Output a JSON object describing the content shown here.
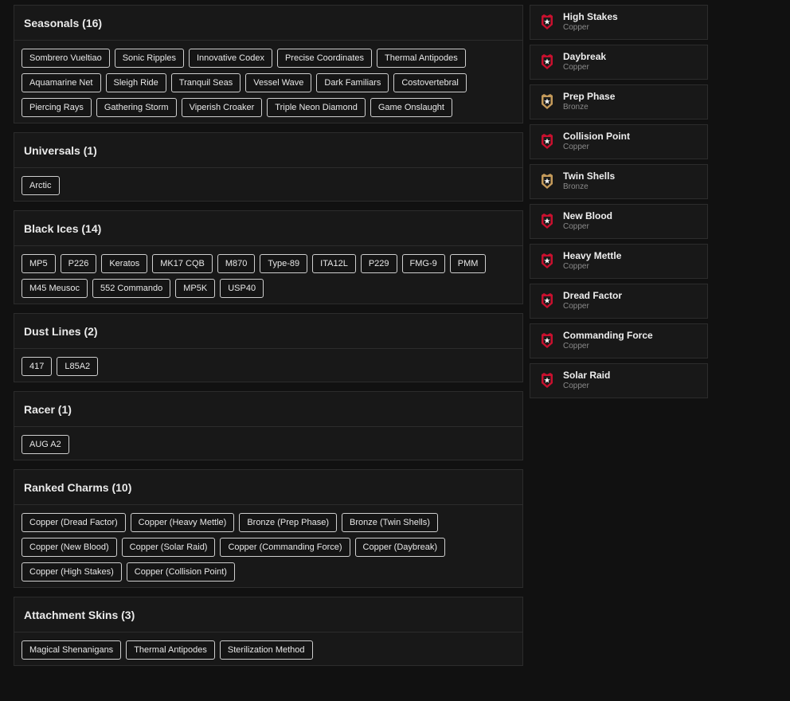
{
  "sections": [
    {
      "title": "Seasonals (16)",
      "items": [
        "Sombrero Vueltiao",
        "Sonic Ripples",
        "Innovative Codex",
        "Precise Coordinates",
        "Thermal Antipodes",
        "Aquamarine Net",
        "Sleigh Ride",
        "Tranquil Seas",
        "Vessel Wave",
        "Dark Familiars",
        "Costovertebral",
        "Piercing Rays",
        "Gathering Storm",
        "Viperish Croaker",
        "Triple Neon Diamond",
        "Game Onslaught"
      ]
    },
    {
      "title": "Universals (1)",
      "items": [
        "Arctic"
      ]
    },
    {
      "title": "Black Ices (14)",
      "items": [
        "MP5",
        "P226",
        "Keratos",
        "MK17 CQB",
        "M870",
        "Type-89",
        "ITA12L",
        "P229",
        "FMG-9",
        "PMM",
        "M45 Meusoc",
        "552 Commando",
        "MP5K",
        "USP40"
      ]
    },
    {
      "title": "Dust Lines (2)",
      "items": [
        "417",
        "L85A2"
      ]
    },
    {
      "title": "Racer (1)",
      "items": [
        "AUG A2"
      ]
    },
    {
      "title": "Ranked Charms (10)",
      "items": [
        "Copper (Dread Factor)",
        "Copper (Heavy Mettle)",
        "Bronze (Prep Phase)",
        "Bronze (Twin Shells)",
        "Copper (New Blood)",
        "Copper (Solar Raid)",
        "Copper (Commanding Force)",
        "Copper (Daybreak)",
        "Copper (High Stakes)",
        "Copper (Collision Point)"
      ]
    },
    {
      "title": "Attachment Skins (3)",
      "items": [
        "Magical Shenanigans",
        "Thermal Antipodes",
        "Sterilization Method"
      ]
    }
  ],
  "charms": [
    {
      "name": "High Stakes",
      "tier": "Copper"
    },
    {
      "name": "Daybreak",
      "tier": "Copper"
    },
    {
      "name": "Prep Phase",
      "tier": "Bronze"
    },
    {
      "name": "Collision Point",
      "tier": "Copper"
    },
    {
      "name": "Twin Shells",
      "tier": "Bronze"
    },
    {
      "name": "New Blood",
      "tier": "Copper"
    },
    {
      "name": "Heavy Mettle",
      "tier": "Copper"
    },
    {
      "name": "Dread Factor",
      "tier": "Copper"
    },
    {
      "name": "Commanding Force",
      "tier": "Copper"
    },
    {
      "name": "Solar Raid",
      "tier": "Copper"
    }
  ],
  "colors": {
    "copper_badge": "#c8102e",
    "bronze_badge": "#c49a5a",
    "background": "#111111",
    "panel": "#181818"
  }
}
